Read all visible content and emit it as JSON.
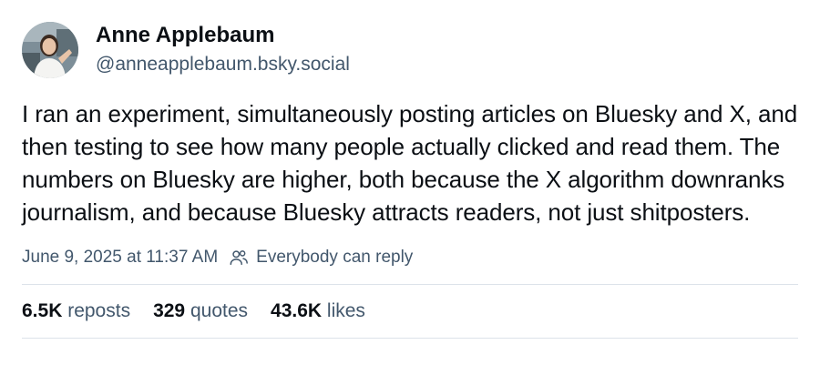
{
  "author": {
    "display_name": "Anne Applebaum",
    "handle": "@anneapplebaum.bsky.social",
    "avatar_icon": "profile-photo"
  },
  "post": {
    "text": "I ran an experiment, simultaneously posting articles on Bluesky and X, and then testing to see how many people actually clicked and read them. The numbers on Bluesky are higher, both because the X algorithm downranks journalism, and because Bluesky attracts readers, not just shitposters.",
    "timestamp": "June 9, 2025 at 11:37 AM",
    "reply_setting": "Everybody can reply",
    "reply_icon": "people-icon"
  },
  "stats": {
    "reposts_count": "6.5K",
    "reposts_label": "reposts",
    "quotes_count": "329",
    "quotes_label": "quotes",
    "likes_count": "43.6K",
    "likes_label": "likes"
  },
  "colors": {
    "text_primary": "#0b0f14",
    "text_secondary": "#42576c",
    "divider": "#dde3ea",
    "background": "#ffffff"
  }
}
